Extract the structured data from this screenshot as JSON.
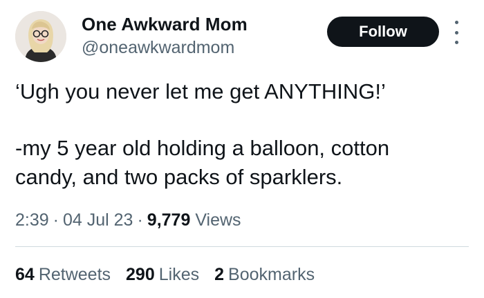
{
  "user": {
    "display_name": "One Awkward Mom",
    "handle": "@oneawkwardmom"
  },
  "actions": {
    "follow_label": "Follow",
    "more_icon": "more-vertical-icon"
  },
  "tweet": {
    "line1": "‘Ugh you never let me get ANYTHING!’",
    "line2": "-my 5 year old holding a balloon, cotton",
    "line3": "candy, and two packs of sparklers."
  },
  "meta": {
    "time": "2:39",
    "date": "04 Jul 23",
    "views_count": "9,779",
    "views_label": "Views"
  },
  "stats": {
    "retweets_count": "64",
    "retweets_label": "Retweets",
    "likes_count": "290",
    "likes_label": "Likes",
    "bookmarks_count": "2",
    "bookmarks_label": "Bookmarks"
  },
  "colors": {
    "text_primary": "#0f1419",
    "text_secondary": "#536471",
    "button_bg": "#0f1419",
    "divider": "#cfd9de"
  }
}
